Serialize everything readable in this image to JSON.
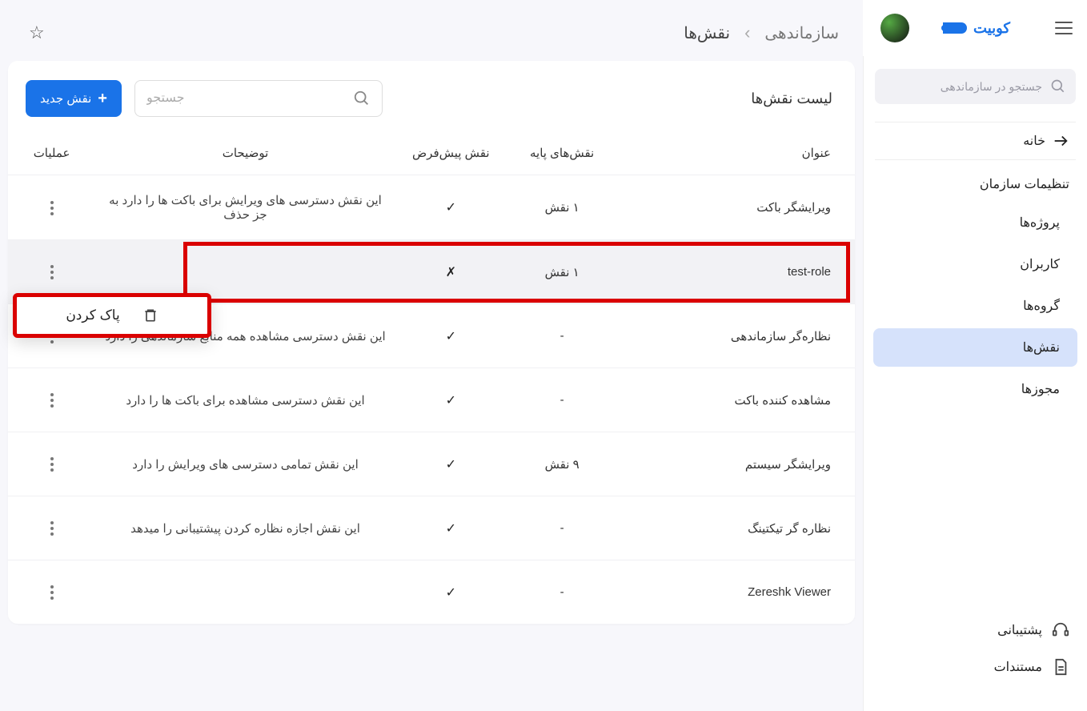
{
  "brand": "کوبیت",
  "search_org_placeholder": "جستجو در سازماندهی",
  "nav": {
    "home": "خانه",
    "section_title": "تنظیمات سازمان",
    "items": [
      "پروژه‌ها",
      "کاربران",
      "گروه‌ها",
      "نقش‌ها",
      "مجوزها"
    ],
    "active_index": 3,
    "support": "پشتیبانی",
    "docs": "مستندات"
  },
  "breadcrumb": {
    "level1": "سازماندهی",
    "level2": "نقش‌ها"
  },
  "card": {
    "title": "لیست نقش‌ها",
    "search_placeholder": "جستجو",
    "new_button": "نقش جدید"
  },
  "table": {
    "headers": {
      "title": "عنوان",
      "base_roles": "نقش‌های پایه",
      "default_role": "نقش پیش‌فرض",
      "description": "توضیحات",
      "actions": "عملیات"
    },
    "rows": [
      {
        "title": "ویرایشگر باکت",
        "base": "۱ نقش",
        "default": "✓",
        "desc": "این نقش دسترسی های ویرایش برای باکت ها را دارد به جز حذف"
      },
      {
        "title": "test-role",
        "base": "۱ نقش",
        "default": "✗",
        "desc": "",
        "highlighted": true
      },
      {
        "title": "نظاره‌گر سازماندهی",
        "base": "-",
        "default": "✓",
        "desc": "این نقش دسترسی مشاهده همه منابع سازماندهی را دارد"
      },
      {
        "title": "مشاهده کننده باکت",
        "base": "-",
        "default": "✓",
        "desc": "این نقش دسترسی مشاهده برای باکت ها را دارد"
      },
      {
        "title": "ویرایشگر سیستم",
        "base": "۹ نقش",
        "default": "✓",
        "desc": "این نقش تمامی دسترسی های ویرایش را دارد"
      },
      {
        "title": "نظاره گر تیکتینگ",
        "base": "-",
        "default": "✓",
        "desc": "این نقش اجازه نظاره کردن پیشتیبانی را میدهد"
      },
      {
        "title": "Zereshk Viewer",
        "base": "-",
        "default": "✓",
        "desc": ""
      }
    ]
  },
  "popup": {
    "delete_label": "پاک کردن"
  }
}
